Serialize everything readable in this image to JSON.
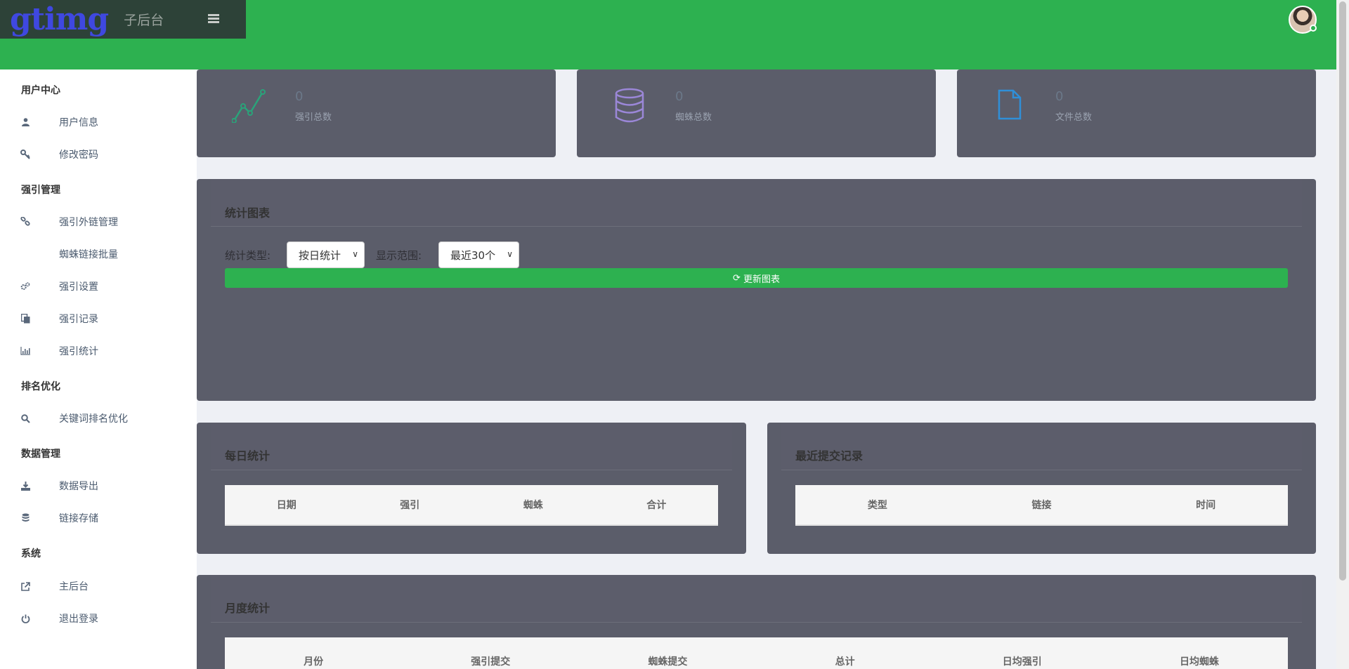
{
  "brand": {
    "logo": "gtimg",
    "subtitle": "子后台"
  },
  "sidebar": {
    "sections": [
      {
        "title": "用户中心",
        "items": [
          {
            "label": "用户信息",
            "icon": "user-icon"
          },
          {
            "label": "修改密码",
            "icon": "key-icon"
          }
        ]
      },
      {
        "title": "强引管理",
        "items": [
          {
            "label": "强引外链管理",
            "icon": "link-icon"
          },
          {
            "label": "蜘蛛链接批量",
            "icon": ""
          },
          {
            "label": "强引设置",
            "icon": "gears-icon"
          },
          {
            "label": "强引记录",
            "icon": "copy-icon"
          },
          {
            "label": "强引统计",
            "icon": "bar-chart-icon"
          }
        ]
      },
      {
        "title": "排名优化",
        "items": [
          {
            "label": "关键词排名优化",
            "icon": "search-icon"
          }
        ]
      },
      {
        "title": "数据管理",
        "items": [
          {
            "label": "数据导出",
            "icon": "download-icon"
          },
          {
            "label": "链接存储",
            "icon": "database-icon"
          }
        ]
      },
      {
        "title": "系统",
        "items": [
          {
            "label": "主后台",
            "icon": "external-link-icon"
          },
          {
            "label": "退出登录",
            "icon": "power-icon"
          }
        ]
      }
    ]
  },
  "stats": [
    {
      "value": "0",
      "label": "强引总数",
      "icon": "line-chart-icon",
      "color": "#2aa37a"
    },
    {
      "value": "0",
      "label": "蜘蛛总数",
      "icon": "database-icon",
      "color": "#9b87d8"
    },
    {
      "value": "0",
      "label": "文件总数",
      "icon": "file-icon",
      "color": "#2f8fd8"
    }
  ],
  "chart_panel": {
    "title": "统计图表",
    "type_label": "统计类型:",
    "type_value": "按日统计",
    "range_label": "显示范围:",
    "range_value": "最近30个",
    "update_button": "更新图表"
  },
  "daily": {
    "title": "每日统计",
    "columns": [
      "日期",
      "强引",
      "蜘蛛",
      "合计"
    ]
  },
  "recent": {
    "title": "最近提交记录",
    "columns": [
      "类型",
      "链接",
      "时间"
    ]
  },
  "monthly": {
    "title": "月度统计",
    "columns": [
      "月份",
      "强引提交",
      "蜘蛛提交",
      "总计",
      "日均强引",
      "日均蜘蛛"
    ]
  }
}
